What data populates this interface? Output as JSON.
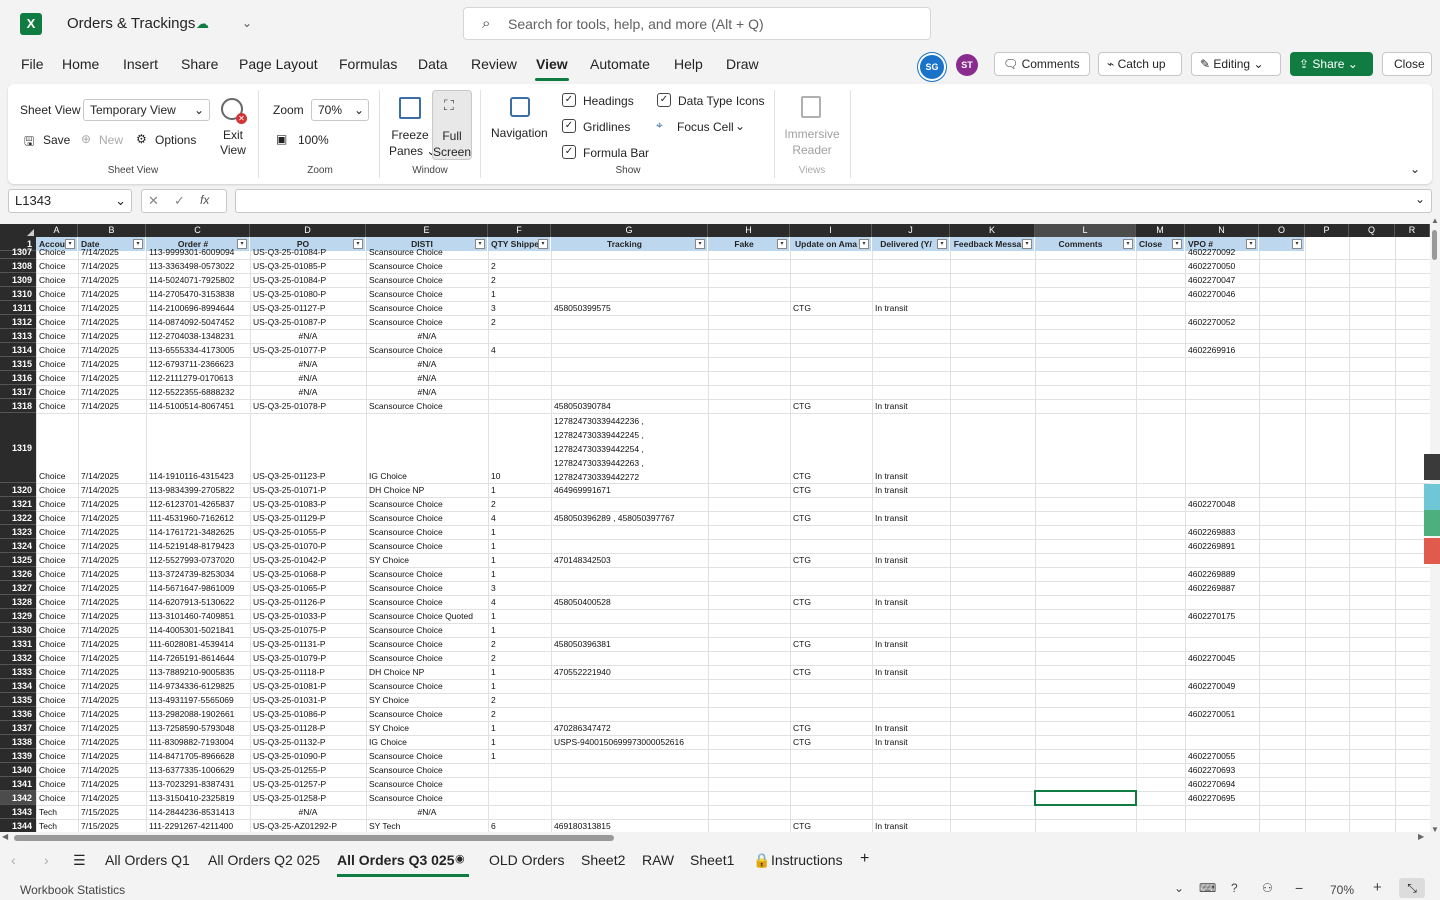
{
  "title": {
    "app_letter": "X",
    "doc_name": "Orders & Trackings"
  },
  "search": {
    "placeholder": "Search for tools, help, and more (Alt + Q)"
  },
  "menu": [
    "File",
    "Home",
    "Insert",
    "Share",
    "Page Layout",
    "Formulas",
    "Data",
    "Review",
    "View",
    "Automate",
    "Help",
    "Draw"
  ],
  "active_menu": "View",
  "avatars": [
    {
      "initials": "SG",
      "color": "#1a73c8"
    },
    {
      "initials": "ST",
      "color": "#8a2c8f"
    }
  ],
  "toolbar": {
    "comments": "Comments",
    "catch_up": "Catch up",
    "editing": "Editing",
    "share": "Share",
    "close": "Close",
    "accent": "#107c41"
  },
  "ribbon": {
    "sheet_view_label": "Sheet View",
    "sheet_view_value": "Temporary View",
    "save": "Save",
    "new": "New",
    "options": "Options",
    "exit_view": [
      "Exit",
      "View"
    ],
    "group_sheet_view": "Sheet View",
    "zoom_label": "Zoom",
    "zoom_value": "70%",
    "zoom_100": "100%",
    "group_zoom": "Zoom",
    "freeze": [
      "Freeze",
      "Panes"
    ],
    "full_screen": [
      "Full",
      "Screen"
    ],
    "group_window": "Window",
    "navigation": "Navigation",
    "headings": "Headings",
    "gridlines": "Gridlines",
    "formula_bar": "Formula Bar",
    "data_type_icons": "Data Type Icons",
    "focus_cell": "Focus Cell",
    "group_show": "Show",
    "immersive": [
      "Immersive",
      "Reader"
    ],
    "group_views": "Views"
  },
  "namebox": "L1343",
  "columns": [
    "A",
    "B",
    "C",
    "D",
    "E",
    "F",
    "G",
    "H",
    "I",
    "J",
    "K",
    "L",
    "M",
    "N",
    "O",
    "P",
    "Q",
    "R"
  ],
  "selected_column": "L",
  "header_row": {
    "row_number": "1",
    "cells": [
      "Accou",
      "Date",
      "Order #",
      "PO",
      "DISTI",
      "QTY Shippe",
      "Tracking",
      "Fake",
      "Update on Ama",
      "Delivered (Y/",
      "Feedback Messa",
      "Comments",
      "Close",
      "VPO #",
      ""
    ]
  },
  "rows": [
    [
      "1307",
      "Choice",
      "7/14/2025",
      "113-9999301-6009094",
      "US-Q3-25-01084-P",
      "Scansource Choice",
      "",
      "",
      "",
      "",
      "",
      "",
      "",
      "",
      "4602270092"
    ],
    [
      "1308",
      "Choice",
      "7/14/2025",
      "113-3363498-0573022",
      "US-Q3-25-01085-P",
      "Scansource Choice",
      "2",
      "",
      "",
      "",
      "",
      "",
      "",
      "",
      "4602270050"
    ],
    [
      "1309",
      "Choice",
      "7/14/2025",
      "114-5024071-7925802",
      "US-Q3-25-01084-P",
      "Scansource Choice",
      "2",
      "",
      "",
      "",
      "",
      "",
      "",
      "",
      "4602270047"
    ],
    [
      "1310",
      "Choice",
      "7/14/2025",
      "114-2705470-3153838",
      "US-Q3-25-01080-P",
      "Scansource Choice",
      "1",
      "",
      "",
      "",
      "",
      "",
      "",
      "",
      "4602270046"
    ],
    [
      "1311",
      "Choice",
      "7/14/2025",
      "114-2100696-8994644",
      "US-Q3-25-01127-P",
      "Scansource Choice",
      "3",
      "458050399575",
      "",
      "CTG",
      "In transit",
      "",
      "",
      "",
      ""
    ],
    [
      "1312",
      "Choice",
      "7/14/2025",
      "114-0874092-5047452",
      "US-Q3-25-01087-P",
      "Scansource Choice",
      "2",
      "",
      "",
      "",
      "",
      "",
      "",
      "",
      "4602270052"
    ],
    [
      "1313",
      "Choice",
      "7/14/2025",
      "112-2704038-1348231",
      "#N/A",
      "#N/A",
      "",
      "",
      "",
      "",
      "",
      "",
      "",
      "",
      ""
    ],
    [
      "1314",
      "Choice",
      "7/14/2025",
      "113-6555334-4173005",
      "US-Q3-25-01077-P",
      "Scansource Choice",
      "4",
      "",
      "",
      "",
      "",
      "",
      "",
      "",
      "4602269916"
    ],
    [
      "1315",
      "Choice",
      "7/14/2025",
      "112-6793711-2366623",
      "#N/A",
      "#N/A",
      "",
      "",
      "",
      "",
      "",
      "",
      "",
      "",
      ""
    ],
    [
      "1316",
      "Choice",
      "7/14/2025",
      "112-2111279-0170613",
      "#N/A",
      "#N/A",
      "",
      "",
      "",
      "",
      "",
      "",
      "",
      "",
      ""
    ],
    [
      "1317",
      "Choice",
      "7/14/2025",
      "112-5522355-6888232",
      "#N/A",
      "#N/A",
      "",
      "",
      "",
      "",
      "",
      "",
      "",
      "",
      ""
    ],
    [
      "1318",
      "Choice",
      "7/14/2025",
      "114-5100514-8067451",
      "US-Q3-25-01078-P",
      "Scansource Choice",
      "",
      "458050390784",
      "",
      "CTG",
      "In transit",
      "",
      "",
      "",
      ""
    ],
    [
      "1319",
      "Choice",
      "7/14/2025",
      "114-1910116-4315423",
      "US-Q3-25-01123-P",
      "IG Choice",
      "10",
      "127824730339442236 ,\n127824730339442245 ,\n127824730339442254 ,\n127824730339442263 ,\n127824730339442272",
      "",
      "CTG",
      "In transit",
      "",
      "",
      "",
      ""
    ],
    [
      "1320",
      "Choice",
      "7/14/2025",
      "113-9834399-2705822",
      "US-Q3-25-01071-P",
      "DH Choice NP",
      "1",
      "464969991671",
      "",
      "CTG",
      "In transit",
      "",
      "",
      "",
      ""
    ],
    [
      "1321",
      "Choice",
      "7/14/2025",
      "112-6123701-4265837",
      "US-Q3-25-01083-P",
      "Scansource Choice",
      "2",
      "",
      "",
      "",
      "",
      "",
      "",
      "",
      "4602270048"
    ],
    [
      "1322",
      "Choice",
      "7/14/2025",
      "111-4531960-7162612",
      "US-Q3-25-01129-P",
      "Scansource Choice",
      "4",
      "458050396289 , 458050397767",
      "",
      "CTG",
      "In transit",
      "",
      "",
      "",
      ""
    ],
    [
      "1323",
      "Choice",
      "7/14/2025",
      "114-1761721-3482625",
      "US-Q3-25-01055-P",
      "Scansource Choice",
      "1",
      "",
      "",
      "",
      "",
      "",
      "",
      "",
      "4602269883"
    ],
    [
      "1324",
      "Choice",
      "7/14/2025",
      "114-5219148-8179423",
      "US-Q3-25-01070-P",
      "Scansource Choice",
      "1",
      "",
      "",
      "",
      "",
      "",
      "",
      "",
      "4602269891"
    ],
    [
      "1325",
      "Choice",
      "7/14/2025",
      "112-5527993-0737020",
      "US-Q3-25-01042-P",
      "SY Choice",
      "1",
      "470148342503",
      "",
      "CTG",
      "In transit",
      "",
      "",
      "",
      ""
    ],
    [
      "1326",
      "Choice",
      "7/14/2025",
      "113-3724739-8253034",
      "US-Q3-25-01068-P",
      "Scansource Choice",
      "1",
      "",
      "",
      "",
      "",
      "",
      "",
      "",
      "4602269889"
    ],
    [
      "1327",
      "Choice",
      "7/14/2025",
      "114-5671647-9861009",
      "US-Q3-25-01065-P",
      "Scansource Choice",
      "3",
      "",
      "",
      "",
      "",
      "",
      "",
      "",
      "4602269887"
    ],
    [
      "1328",
      "Choice",
      "7/14/2025",
      "114-6207913-5130622",
      "US-Q3-25-01126-P",
      "Scansource Choice",
      "4",
      "458050400528",
      "",
      "CTG",
      "In transit",
      "",
      "",
      "",
      ""
    ],
    [
      "1329",
      "Choice",
      "7/14/2025",
      "113-3101460-7409851",
      "US-Q3-25-01033-P",
      "Scansource Choice Quoted",
      "1",
      "",
      "",
      "",
      "",
      "",
      "",
      "",
      "4602270175"
    ],
    [
      "1330",
      "Choice",
      "7/14/2025",
      "114-4005301-5021841",
      "US-Q3-25-01075-P",
      "Scansource Choice",
      "1",
      "",
      "",
      "",
      "",
      "",
      "",
      "",
      ""
    ],
    [
      "1331",
      "Choice",
      "7/14/2025",
      "111-6028081-4539414",
      "US-Q3-25-01131-P",
      "Scansource Choice",
      "2",
      "458050396381",
      "",
      "CTG",
      "In transit",
      "",
      "",
      "",
      ""
    ],
    [
      "1332",
      "Choice",
      "7/14/2025",
      "114-7265191-8614644",
      "US-Q3-25-01079-P",
      "Scansource Choice",
      "2",
      "",
      "",
      "",
      "",
      "",
      "",
      "",
      "4602270045"
    ],
    [
      "1333",
      "Choice",
      "7/14/2025",
      "113-7889210-9005835",
      "US-Q3-25-01118-P",
      "DH Choice NP",
      "1",
      "470552221940",
      "",
      "CTG",
      "In transit",
      "",
      "",
      "",
      ""
    ],
    [
      "1334",
      "Choice",
      "7/14/2025",
      "114-9734336-6129825",
      "US-Q3-25-01081-P",
      "Scansource Choice",
      "1",
      "",
      "",
      "",
      "",
      "",
      "",
      "",
      "4602270049"
    ],
    [
      "1335",
      "Choice",
      "7/14/2025",
      "113-4931197-5565069",
      "US-Q3-25-01031-P",
      "SY Choice",
      "2",
      "",
      "",
      "",
      "",
      "",
      "",
      "",
      ""
    ],
    [
      "1336",
      "Choice",
      "7/14/2025",
      "113-2982088-1902661",
      "US-Q3-25-01086-P",
      "Scansource Choice",
      "2",
      "",
      "",
      "",
      "",
      "",
      "",
      "",
      "4602270051"
    ],
    [
      "1337",
      "Choice",
      "7/14/2025",
      "113-7258590-5793048",
      "US-Q3-25-01128-P",
      "SY Choice",
      "1",
      "470286347472",
      "",
      "CTG",
      "In transit",
      "",
      "",
      "",
      ""
    ],
    [
      "1338",
      "Choice",
      "7/14/2025",
      "111-8309882-7193004",
      "US-Q3-25-01132-P",
      "IG Choice",
      "1",
      "USPS-9400150699973000052616",
      "",
      "CTG",
      "In transit",
      "",
      "",
      "",
      ""
    ],
    [
      "1339",
      "Choice",
      "7/14/2025",
      "114-8471705-8966628",
      "US-Q3-25-01090-P",
      "Scansource Choice",
      "1",
      "",
      "",
      "",
      "",
      "",
      "",
      "",
      "4602270055"
    ],
    [
      "1340",
      "Choice",
      "7/14/2025",
      "113-6377335-1006629",
      "US-Q3-25-01255-P",
      "Scansource Choice",
      "",
      "",
      "",
      "",
      "",
      "",
      "",
      "",
      "4602270693"
    ],
    [
      "1341",
      "Choice",
      "7/14/2025",
      "113-7023291-8387431",
      "US-Q3-25-01257-P",
      "Scansource Choice",
      "",
      "",
      "",
      "",
      "",
      "",
      "",
      "",
      "4602270694"
    ],
    [
      "1342",
      "Choice",
      "7/14/2025",
      "113-3150410-2325819",
      "US-Q3-25-01258-P",
      "Scansource Choice",
      "",
      "",
      "",
      "",
      "",
      "",
      "",
      "",
      "4602270695"
    ],
    [
      "1343",
      "Tech",
      "7/15/2025",
      "114-2844236-8531413",
      "#N/A",
      "#N/A",
      "",
      "",
      "",
      "",
      "",
      "",
      "",
      "",
      ""
    ],
    [
      "1344",
      "Tech",
      "7/15/2025",
      "111-2291267-4211400",
      "US-Q3-25-AZ01292-P",
      "SY Tech",
      "6",
      "469180313815",
      "",
      "CTG",
      "In transit",
      "",
      "",
      "",
      ""
    ]
  ],
  "selected_row": "1342",
  "sheet_tabs": [
    "All Orders Q1",
    "All Orders Q2 025",
    "All Orders Q3 025",
    "OLD Orders",
    "Sheet2",
    "RAW",
    "Sheet1",
    "Instructions"
  ],
  "active_tab": "All Orders Q3 025",
  "status": {
    "left": "Workbook Statistics",
    "zoom": "70%"
  }
}
